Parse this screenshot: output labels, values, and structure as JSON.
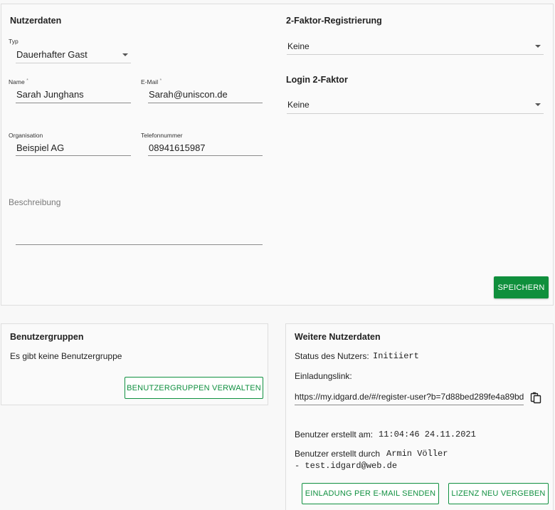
{
  "user_data": {
    "title": "Nutzerdaten",
    "type": {
      "label": "Typ",
      "value": "Dauerhafter Gast"
    },
    "name": {
      "label": "Name",
      "required_mark": "*",
      "value": "Sarah Junghans"
    },
    "email": {
      "label": "E-Mail",
      "required_mark": "*",
      "value": "Sarah@uniscon.de"
    },
    "organisation": {
      "label": "Organisation",
      "value": "Beispiel AG"
    },
    "phone": {
      "label": "Telefonnummer",
      "value": "08941615987"
    },
    "description": {
      "placeholder": "Beschreibung",
      "value": ""
    }
  },
  "two_factor": {
    "registration_title": "2-Faktor-Registrierung",
    "registration_value": "Keine",
    "login_title": "Login 2-Faktor",
    "login_value": "Keine"
  },
  "save_button": "SPEICHERN",
  "user_groups": {
    "title": "Benutzergruppen",
    "empty_text": "Es gibt keine Benutzergruppe",
    "manage_button": "BENUTZERGRUPPEN VERWALTEN"
  },
  "more_data": {
    "title": "Weitere Nutzerdaten",
    "status_label": "Status des Nutzers:",
    "status_value": "Initiiert",
    "invite_label": "Einladungslink:",
    "invite_link": "https://my.idgard.de/#/register-user?b=7d88bed289fe4a89bd",
    "created_at_label": "Benutzer erstellt am:",
    "created_at_value": "11:04:46 24.11.2021",
    "created_by_label": "Benutzer erstellt durch",
    "created_by_name": "Armin Völler",
    "created_by_email": "- test.idgard@web.de",
    "send_invite_button": "EINLADUNG PER E-MAIL SENDEN",
    "reassign_license_button": "LIZENZ NEU VERGEBEN"
  },
  "icons": {
    "copy": "copy-icon",
    "dropdown": "chevron-down-icon"
  },
  "colors": {
    "accent": "#0f8f3c",
    "outline": "#109040"
  }
}
